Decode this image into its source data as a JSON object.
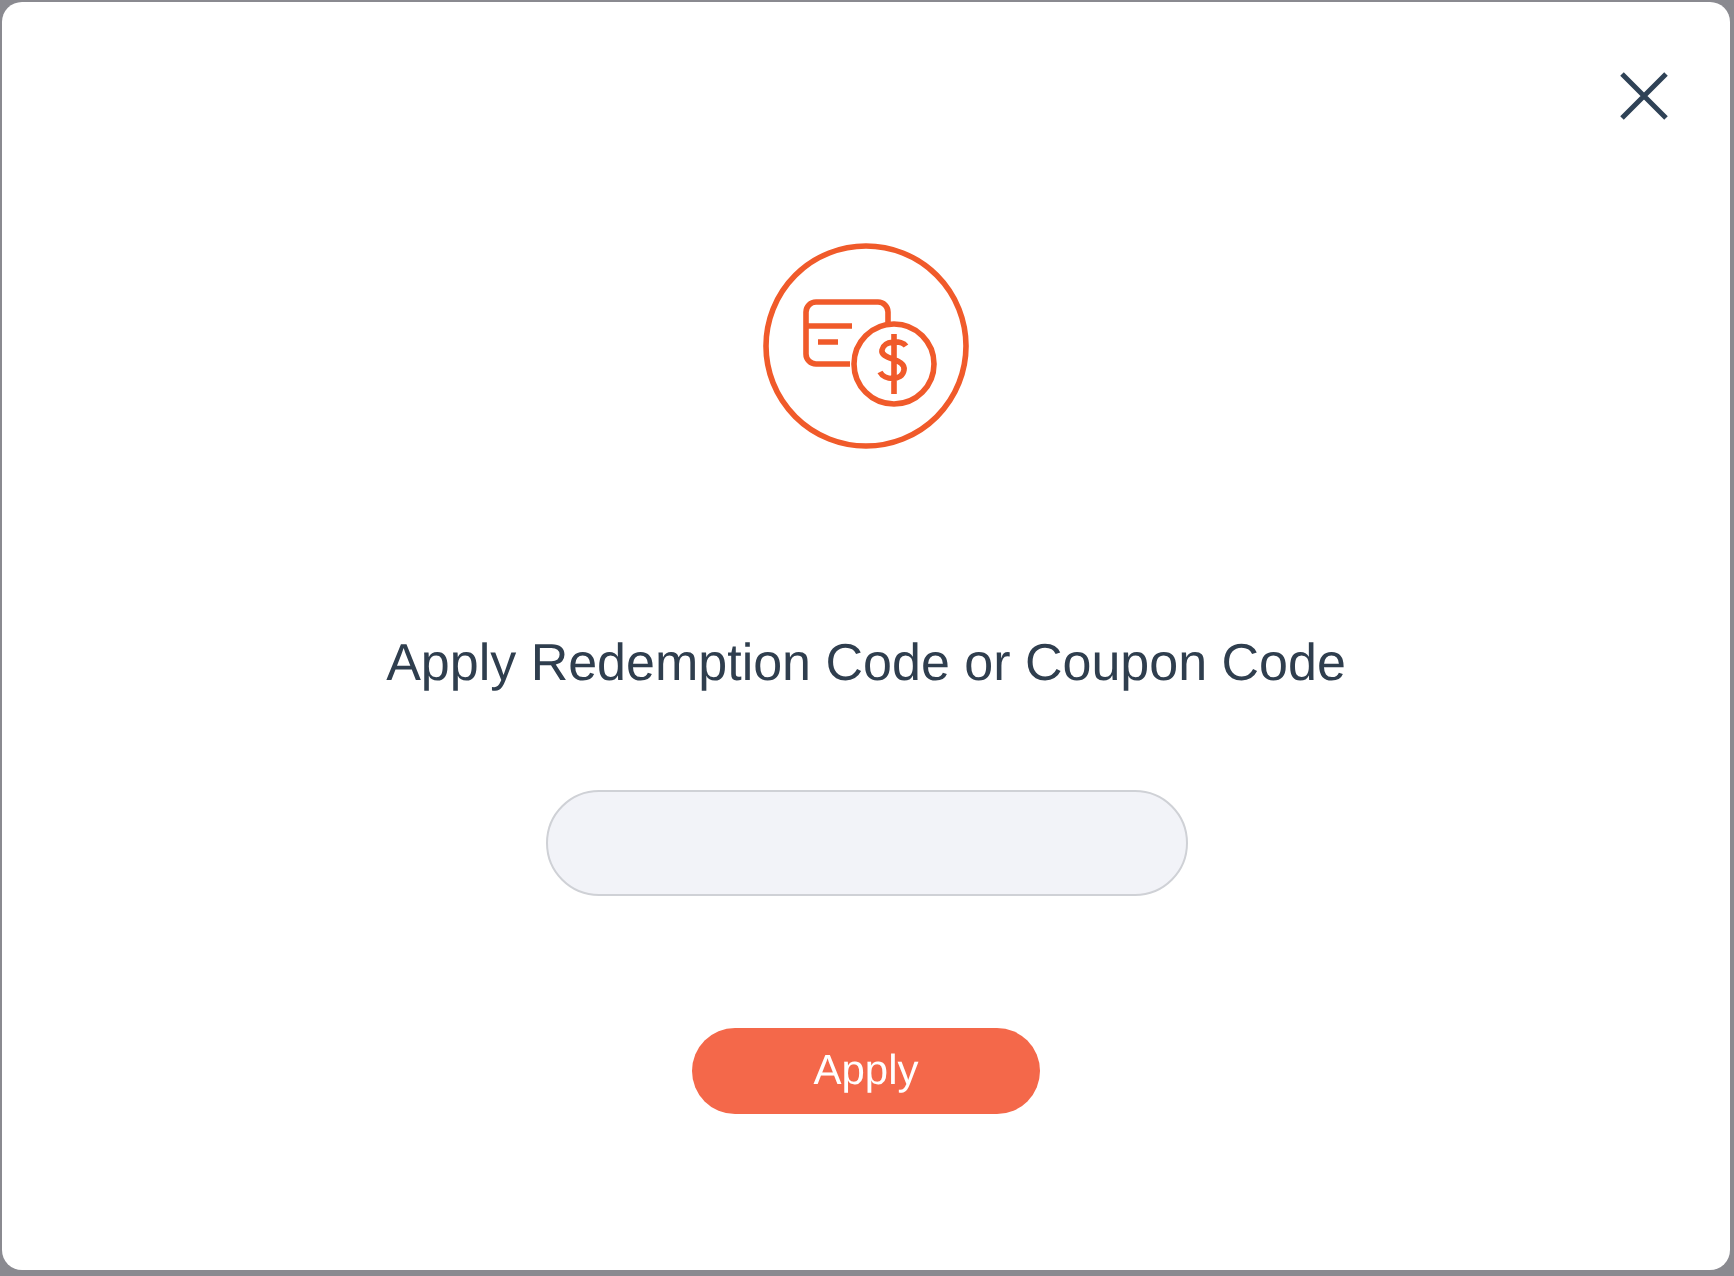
{
  "dialog": {
    "title": "Apply Redemption Code or Coupon Code",
    "buttons": [
      {
        "label": "Apply"
      }
    ]
  }
}
